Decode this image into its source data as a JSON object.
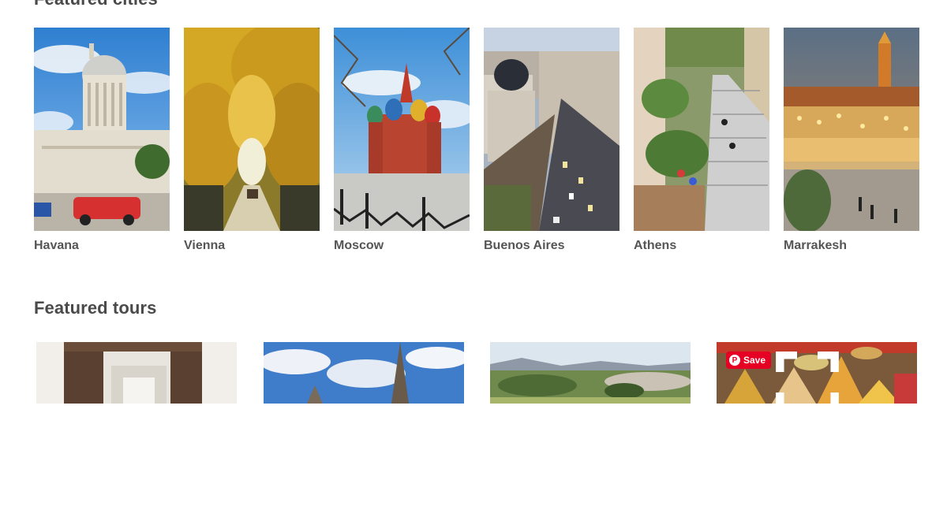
{
  "cities_section": {
    "title": "Featured cities",
    "items": [
      {
        "name": "Havana"
      },
      {
        "name": "Vienna"
      },
      {
        "name": "Moscow"
      },
      {
        "name": "Buenos Aires"
      },
      {
        "name": "Athens"
      },
      {
        "name": "Marrakesh"
      }
    ]
  },
  "tours_section": {
    "title": "Featured tours"
  },
  "pin_overlay": {
    "save_label": "Save",
    "save_color": "#e60023",
    "icons": [
      "pinterest-icon",
      "expand-icon"
    ]
  }
}
